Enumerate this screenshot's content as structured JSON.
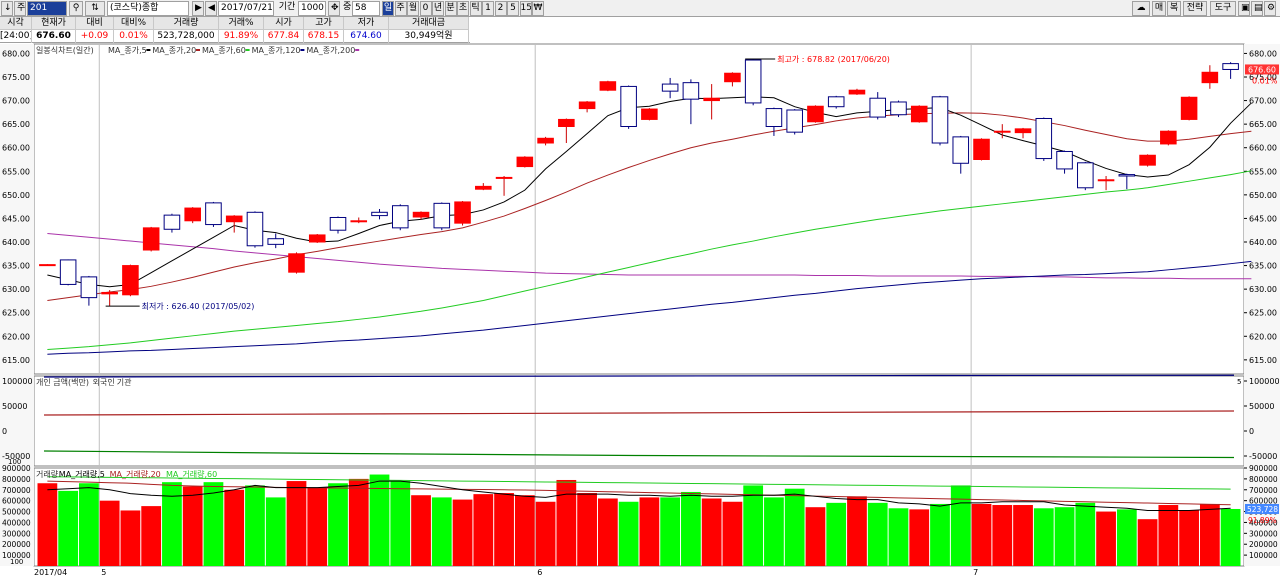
{
  "toolbar": {
    "arrow_down": "↓",
    "market_label": "주",
    "code": "201",
    "market_name": "(코스닥)종합",
    "date": "2017/07/21",
    "period_label": "기간",
    "period": "1000",
    "count_prefix": "중",
    "count": "58",
    "period_buttons": [
      "일",
      "주",
      "월",
      "0",
      "년",
      "분",
      "초",
      "틱",
      "1",
      "2",
      "5",
      "15",
      "₩"
    ],
    "right_buttons": [
      "매",
      "복",
      "전략",
      "도구"
    ]
  },
  "quote": {
    "headers": [
      "시각",
      "현재가",
      "대비",
      "대비%",
      "거래량",
      "거래%",
      "시가",
      "고가",
      "저가",
      "거래대금"
    ],
    "values": [
      "[24:00]",
      "676.60",
      "+0.09",
      "0.01%",
      "523,728,000",
      "91.89%",
      "677.84",
      "678.15",
      "674.60",
      "30,949억원"
    ]
  },
  "colors": {
    "up": "#ff0000",
    "down": "#000080",
    "ma5": "#000000",
    "ma20": "#aa2222",
    "ma60": "#22cc22",
    "ma120": "#000080",
    "ma200": "#aa33aa",
    "vol_up": "#ff0000",
    "vol_down": "#00ff00"
  },
  "chart_data": [
    {
      "type": "candlestick",
      "title": "일봉식차트(일간)",
      "legend": [
        "MA_종가,5",
        "MA_종가,20",
        "MA_종가,60",
        "MA_종가,120",
        "MA_종가,200"
      ],
      "ylim": [
        612,
        682
      ],
      "yticks": [
        "680.00",
        "675.00",
        "670.00",
        "665.00",
        "660.00",
        "655.00",
        "650.00",
        "645.00",
        "640.00",
        "635.00",
        "630.00",
        "625.00",
        "620.00",
        "615.00"
      ],
      "x_labels": [
        "2017/04",
        "5",
        "6",
        "7"
      ],
      "last_price_label": "676.60",
      "last_pct_label": "0.01%",
      "annotations": {
        "high": "최고가 : 678.82 (2017/06/20)",
        "low": "최저가 : 626.40 (2017/05/02)"
      },
      "candles": [
        {
          "o": 635.2,
          "c": 635.2,
          "h": 635.3,
          "l": 635.0
        },
        {
          "o": 636.2,
          "c": 631.0,
          "h": 636.3,
          "l": 630.8
        },
        {
          "o": 632.6,
          "c": 628.2,
          "h": 632.8,
          "l": 626.5
        },
        {
          "o": 629.0,
          "c": 629.3,
          "h": 629.8,
          "l": 626.4
        },
        {
          "o": 628.8,
          "c": 635.0,
          "h": 635.2,
          "l": 628.5
        },
        {
          "o": 638.3,
          "c": 643.0,
          "h": 643.2,
          "l": 638.0
        },
        {
          "o": 645.7,
          "c": 642.7,
          "h": 646.0,
          "l": 642.0
        },
        {
          "o": 644.5,
          "c": 647.2,
          "h": 647.4,
          "l": 644.0
        },
        {
          "o": 648.3,
          "c": 643.7,
          "h": 648.5,
          "l": 643.2
        },
        {
          "o": 644.3,
          "c": 645.5,
          "h": 645.7,
          "l": 642.0
        },
        {
          "o": 646.3,
          "c": 639.2,
          "h": 646.5,
          "l": 638.8
        },
        {
          "o": 640.7,
          "c": 639.5,
          "h": 641.8,
          "l": 638.7
        },
        {
          "o": 633.6,
          "c": 637.5,
          "h": 637.8,
          "l": 633.3
        },
        {
          "o": 640.0,
          "c": 641.5,
          "h": 641.7,
          "l": 639.8
        },
        {
          "o": 645.2,
          "c": 642.5,
          "h": 645.4,
          "l": 641.8
        },
        {
          "o": 644.4,
          "c": 644.5,
          "h": 645.2,
          "l": 644.0
        },
        {
          "o": 646.3,
          "c": 645.6,
          "h": 647.0,
          "l": 644.8
        },
        {
          "o": 647.7,
          "c": 643.0,
          "h": 648.0,
          "l": 642.5
        },
        {
          "o": 645.3,
          "c": 646.3,
          "h": 646.5,
          "l": 644.8
        },
        {
          "o": 648.2,
          "c": 643.0,
          "h": 648.4,
          "l": 642.5
        },
        {
          "o": 644.0,
          "c": 648.5,
          "h": 648.7,
          "l": 643.5
        },
        {
          "o": 651.2,
          "c": 651.8,
          "h": 652.5,
          "l": 651.0
        },
        {
          "o": 653.6,
          "c": 653.7,
          "h": 654.0,
          "l": 649.8
        },
        {
          "o": 656.0,
          "c": 658.0,
          "h": 658.2,
          "l": 655.8
        },
        {
          "o": 661.0,
          "c": 662.0,
          "h": 662.3,
          "l": 660.5
        },
        {
          "o": 664.5,
          "c": 666.0,
          "h": 666.2,
          "l": 661.0
        },
        {
          "o": 668.3,
          "c": 669.7,
          "h": 669.9,
          "l": 667.5
        },
        {
          "o": 672.2,
          "c": 674.0,
          "h": 674.2,
          "l": 672.0
        },
        {
          "o": 673.0,
          "c": 664.5,
          "h": 673.2,
          "l": 664.0
        },
        {
          "o": 666.0,
          "c": 668.2,
          "h": 668.4,
          "l": 665.8
        },
        {
          "o": 673.5,
          "c": 672.0,
          "h": 674.8,
          "l": 670.5
        },
        {
          "o": 673.8,
          "c": 670.3,
          "h": 674.5,
          "l": 665.0
        },
        {
          "o": 670.0,
          "c": 670.5,
          "h": 673.5,
          "l": 666.0
        },
        {
          "o": 674.0,
          "c": 675.8,
          "h": 676.0,
          "l": 673.0
        },
        {
          "o": 678.6,
          "c": 669.5,
          "h": 678.82,
          "l": 669.0
        },
        {
          "o": 668.3,
          "c": 664.5,
          "h": 668.5,
          "l": 662.5
        },
        {
          "o": 668.0,
          "c": 663.3,
          "h": 668.2,
          "l": 662.8
        },
        {
          "o": 665.5,
          "c": 668.8,
          "h": 669.0,
          "l": 665.3
        },
        {
          "o": 670.8,
          "c": 668.7,
          "h": 671.0,
          "l": 668.3
        },
        {
          "o": 671.4,
          "c": 672.2,
          "h": 672.5,
          "l": 671.2
        },
        {
          "o": 670.5,
          "c": 666.5,
          "h": 671.8,
          "l": 666.0
        },
        {
          "o": 669.7,
          "c": 667.0,
          "h": 670.0,
          "l": 666.5
        },
        {
          "o": 665.5,
          "c": 668.8,
          "h": 669.0,
          "l": 665.3
        },
        {
          "o": 670.8,
          "c": 661.0,
          "h": 671.0,
          "l": 660.5
        },
        {
          "o": 662.3,
          "c": 656.7,
          "h": 662.5,
          "l": 654.5
        },
        {
          "o": 657.5,
          "c": 661.8,
          "h": 662.0,
          "l": 657.3
        },
        {
          "o": 663.5,
          "c": 663.5,
          "h": 665.0,
          "l": 662.0
        },
        {
          "o": 663.2,
          "c": 664.0,
          "h": 664.2,
          "l": 662.0
        },
        {
          "o": 666.2,
          "c": 657.7,
          "h": 666.4,
          "l": 657.2
        },
        {
          "o": 659.2,
          "c": 655.5,
          "h": 659.4,
          "l": 654.5
        },
        {
          "o": 656.8,
          "c": 651.5,
          "h": 657.0,
          "l": 651.0
        },
        {
          "o": 653.0,
          "c": 653.2,
          "h": 654.0,
          "l": 651.0
        },
        {
          "o": 654.3,
          "c": 654.0,
          "h": 654.5,
          "l": 651.2
        },
        {
          "o": 656.3,
          "c": 658.4,
          "h": 658.6,
          "l": 656.0
        },
        {
          "o": 660.8,
          "c": 663.5,
          "h": 663.7,
          "l": 660.5
        },
        {
          "o": 666.0,
          "c": 670.7,
          "h": 670.9,
          "l": 665.8
        },
        {
          "o": 673.8,
          "c": 676.0,
          "h": 677.5,
          "l": 672.5
        },
        {
          "o": 677.84,
          "c": 676.6,
          "h": 678.15,
          "l": 674.6
        }
      ],
      "ma5": [
        633,
        632,
        631,
        630.5,
        631,
        633.5,
        636,
        638.5,
        641,
        643.5,
        642.5,
        642,
        640.8,
        640,
        640.2,
        641.8,
        643.5,
        644.4,
        644.8,
        645.6,
        645.8,
        646.8,
        648.5,
        651,
        655.5,
        659.2,
        663,
        666.8,
        668.5,
        668.8,
        669.8,
        670.5,
        670.4,
        670.6,
        670.8,
        670.6,
        668.7,
        667.5,
        666.6,
        667.4,
        667.7,
        668.1,
        668.3,
        668.5,
        666.9,
        664.8,
        662.7,
        661.5,
        660.4,
        659.2,
        657.3,
        655.6,
        654.3,
        653.8,
        654.2,
        656.4,
        660.1,
        665.2,
        669.5
      ],
      "ma20": [
        627.6,
        628.2,
        628.8,
        629.4,
        629.9,
        630.6,
        631.5,
        632.5,
        633.6,
        634.7,
        635.6,
        636.4,
        637.3,
        638,
        638.8,
        639.5,
        640.2,
        640.9,
        641.6,
        642.2,
        643,
        644.2,
        645.5,
        647.1,
        648.8,
        650.6,
        652.5,
        654.2,
        655.8,
        657.3,
        658.7,
        660,
        661,
        661.8,
        662.7,
        663.5,
        664.2,
        664.9,
        665.7,
        666.3,
        666.7,
        667,
        667.2,
        667.3,
        667.4,
        667.3,
        666.9,
        666.3,
        665.5,
        664.7,
        663.7,
        662.8,
        661.9,
        661.4,
        661.4,
        661.8,
        662.4,
        663,
        663.5
      ],
      "ma60": [
        617.2,
        617.5,
        617.8,
        618.2,
        618.6,
        619.1,
        619.6,
        620.1,
        620.6,
        621.1,
        621.5,
        621.9,
        622.3,
        622.7,
        623.1,
        623.6,
        624.1,
        624.7,
        625.3,
        626,
        626.8,
        627.6,
        628.6,
        629.6,
        630.6,
        631.6,
        632.6,
        633.6,
        634.6,
        635.6,
        636.6,
        637.5,
        638.5,
        639.4,
        640.2,
        641.1,
        641.9,
        642.7,
        643.4,
        644.1,
        644.8,
        645.4,
        646,
        646.6,
        647.1,
        647.6,
        648.1,
        648.6,
        649.1,
        649.6,
        650.1,
        650.6,
        651,
        651.5,
        652.2,
        652.9,
        653.6,
        654.3,
        655.1
      ],
      "ma120": [
        616.2,
        616.4,
        616.5,
        616.7,
        616.9,
        617,
        617.2,
        617.4,
        617.6,
        617.8,
        618,
        618.2,
        618.4,
        618.7,
        619,
        619.2,
        619.5,
        619.8,
        620.1,
        620.5,
        620.9,
        621.3,
        621.8,
        622.3,
        622.8,
        623.3,
        623.8,
        624.3,
        624.8,
        625.3,
        625.8,
        626.3,
        626.8,
        627.2,
        627.7,
        628.2,
        628.7,
        629.1,
        629.6,
        630.1,
        630.5,
        630.9,
        631.3,
        631.6,
        631.9,
        632.2,
        632.4,
        632.6,
        632.8,
        633,
        633.1,
        633.3,
        633.5,
        633.7,
        634.1,
        634.5,
        634.9,
        635.4,
        635.9
      ],
      "ma200": [
        641.8,
        641.4,
        641,
        640.6,
        640.2,
        639.8,
        639.4,
        639,
        638.6,
        638.1,
        637.7,
        637.3,
        636.9,
        636.5,
        636.1,
        635.7,
        635.3,
        635,
        634.7,
        634.4,
        634.2,
        634,
        633.8,
        633.6,
        633.4,
        633.3,
        633.2,
        633.1,
        633,
        633,
        633,
        633,
        633,
        633,
        633,
        633,
        633,
        632.9,
        632.9,
        632.9,
        632.8,
        632.8,
        632.8,
        632.8,
        632.8,
        632.7,
        632.7,
        632.7,
        632.6,
        632.6,
        632.5,
        632.4,
        632.4,
        632.3,
        632.3,
        632.2,
        632.2,
        632.2,
        632.2
      ]
    },
    {
      "type": "line",
      "title": "개인 금액(백만)",
      "legend": [
        "개인 금액(백만)",
        "외국인",
        "기관"
      ],
      "ylim": [
        -70000,
        110000
      ],
      "yticks": [
        "100000",
        "50000",
        "0",
        "-50000"
      ],
      "series": [
        {
          "name": "개인 금액(백만)",
          "values": [
            108000,
            109000,
            110000,
            111000,
            111500
          ]
        },
        {
          "name": "외국인",
          "values": [
            32000,
            34000,
            36000,
            38000,
            40000
          ]
        },
        {
          "name": "기관",
          "values": [
            -40000,
            -45000,
            -49000,
            -51000,
            -53000
          ]
        }
      ]
    },
    {
      "type": "bar",
      "title": "거래량",
      "legend": [
        "거래량",
        "MA_거래량,5",
        "MA_거래량,20",
        "MA_거래량,60"
      ],
      "ylim": [
        0,
        900000
      ],
      "yticks": [
        "900000",
        "800000",
        "700000",
        "600000",
        "500000",
        "400000",
        "300000",
        "200000",
        "100000"
      ],
      "last_value_label": "523,728",
      "last_pct_label": "91.89%",
      "values": [
        760000,
        690000,
        760000,
        600000,
        510000,
        550000,
        770000,
        730000,
        770000,
        700000,
        740000,
        630000,
        780000,
        720000,
        760000,
        800000,
        840000,
        780000,
        650000,
        630000,
        610000,
        660000,
        670000,
        650000,
        590000,
        790000,
        670000,
        620000,
        590000,
        630000,
        630000,
        680000,
        620000,
        590000,
        740000,
        630000,
        710000,
        540000,
        580000,
        640000,
        580000,
        530000,
        520000,
        570000,
        740000,
        570000,
        560000,
        560000,
        530000,
        540000,
        580000,
        500000,
        520000,
        430000,
        560000,
        510000,
        570000,
        523728
      ],
      "ma5": [
        700000,
        710000,
        720000,
        700000,
        665000,
        650000,
        640000,
        650000,
        670000,
        700000,
        740000,
        720000,
        720000,
        720000,
        730000,
        740000,
        780000,
        780000,
        760000,
        730000,
        700000,
        680000,
        660000,
        640000,
        630000,
        660000,
        660000,
        660000,
        650000,
        650000,
        640000,
        650000,
        640000,
        640000,
        650000,
        650000,
        660000,
        640000,
        620000,
        610000,
        610000,
        580000,
        570000,
        550000,
        580000,
        580000,
        590000,
        590000,
        590000,
        560000,
        550000,
        540000,
        530000,
        510000,
        510000,
        510000,
        520000,
        530000
      ],
      "ma20": [
        780000,
        775000,
        770000,
        765000,
        760000,
        750000,
        740000,
        735000,
        730000,
        728000,
        725000,
        722000,
        720000,
        718000,
        716000,
        714000,
        712000,
        710000,
        708000,
        706000,
        704000,
        702000,
        700000,
        698000,
        694000,
        690000,
        686000,
        682000,
        678000,
        674000,
        670000,
        666000,
        662000,
        658000,
        654000,
        650000,
        646000,
        642000,
        638000,
        634000,
        630000,
        626000,
        622000,
        618000,
        614000,
        610000,
        606000,
        602000,
        598000,
        594000,
        590000,
        586000,
        582000,
        578000,
        574000,
        570000,
        566000,
        562000
      ],
      "ma60": [
        820000,
        818000,
        816000,
        814000,
        812000,
        810000,
        808000,
        806000,
        804000,
        802000,
        800000,
        798000,
        796000,
        794000,
        792000,
        790000,
        788000,
        786000,
        784000,
        782000,
        780000,
        778000,
        776000,
        774000,
        772000,
        770000,
        768000,
        766000,
        764000,
        762000,
        760000,
        758000,
        756000,
        754000,
        752000,
        750000,
        748000,
        746000,
        744000,
        742000,
        740000,
        738000,
        736000,
        734000,
        732000,
        730000,
        728000,
        726000,
        724000,
        722000,
        720000,
        718000,
        716000,
        714000,
        712000,
        710000,
        708000,
        706000
      ]
    }
  ]
}
